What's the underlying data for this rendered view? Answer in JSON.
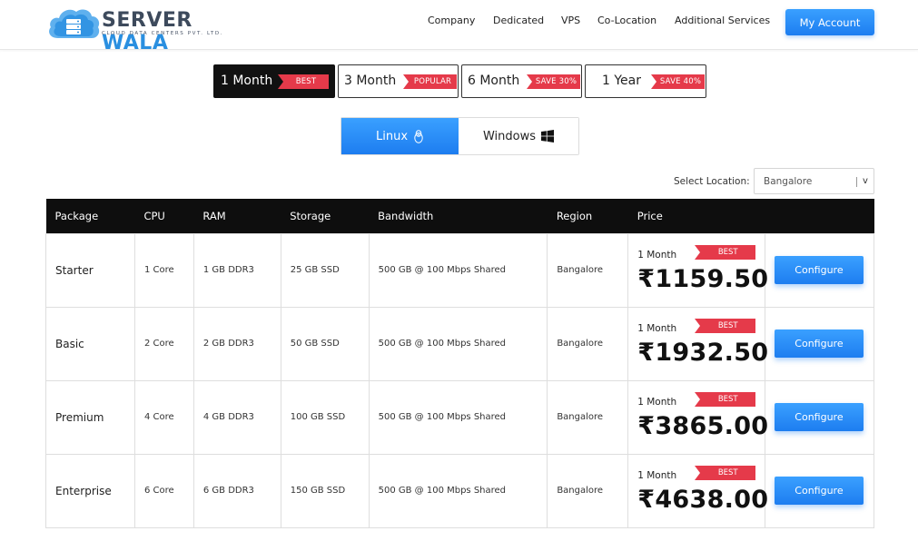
{
  "brand": {
    "name_part1": "SERVER",
    "name_part2": "WALA",
    "tagline": "CLOUD DATA CENTERS PVT. LTD."
  },
  "nav": {
    "items": [
      "Company",
      "Dedicated",
      "VPS",
      "Co-Location",
      "Additional Services"
    ],
    "account_label": "My Account"
  },
  "periods": [
    {
      "label": "1 Month",
      "badge": "BEST",
      "active": true
    },
    {
      "label": "3 Month",
      "badge": "POPULAR",
      "active": false
    },
    {
      "label": "6 Month",
      "badge": "SAVE 30%",
      "active": false
    },
    {
      "label": "1 Year",
      "badge": "SAVE 40%",
      "active": false
    }
  ],
  "os": {
    "linux_label": "Linux",
    "windows_label": "Windows",
    "selected": "Linux"
  },
  "location": {
    "label": "Select Location:",
    "value": "Bangalore",
    "arrow": "v"
  },
  "table": {
    "headers": [
      "Package",
      "CPU",
      "RAM",
      "Storage",
      "Bandwidth",
      "Region",
      "Price",
      ""
    ],
    "rows": [
      {
        "package": "Starter",
        "cpu": "1 Core",
        "ram": "1 GB DDR3",
        "storage": "25 GB SSD",
        "bandwidth": "500 GB @ 100 Mbps Shared",
        "region": "Bangalore",
        "period": "1 Month",
        "badge": "BEST",
        "price": "₹1159.50",
        "action": "Configure"
      },
      {
        "package": "Basic",
        "cpu": "2 Core",
        "ram": "2 GB DDR3",
        "storage": "50 GB SSD",
        "bandwidth": "500 GB @ 100 Mbps Shared",
        "region": "Bangalore",
        "period": "1 Month",
        "badge": "BEST",
        "price": "₹1932.50",
        "action": "Configure"
      },
      {
        "package": "Premium",
        "cpu": "4 Core",
        "ram": "4 GB DDR3",
        "storage": "100 GB SSD",
        "bandwidth": "500 GB @ 100 Mbps Shared",
        "region": "Bangalore",
        "period": "1 Month",
        "badge": "BEST",
        "price": "₹3865.00",
        "action": "Configure"
      },
      {
        "package": "Enterprise",
        "cpu": "6 Core",
        "ram": "6 GB DDR3",
        "storage": "150 GB SSD",
        "bandwidth": "500 GB @ 100 Mbps Shared",
        "region": "Bangalore",
        "period": "1 Month",
        "badge": "BEST",
        "price": "₹4638.00",
        "action": "Configure"
      }
    ]
  },
  "colors": {
    "accent": "#1d7df0",
    "badge": "#e53a4a",
    "header_bg": "#0e0e0e"
  }
}
